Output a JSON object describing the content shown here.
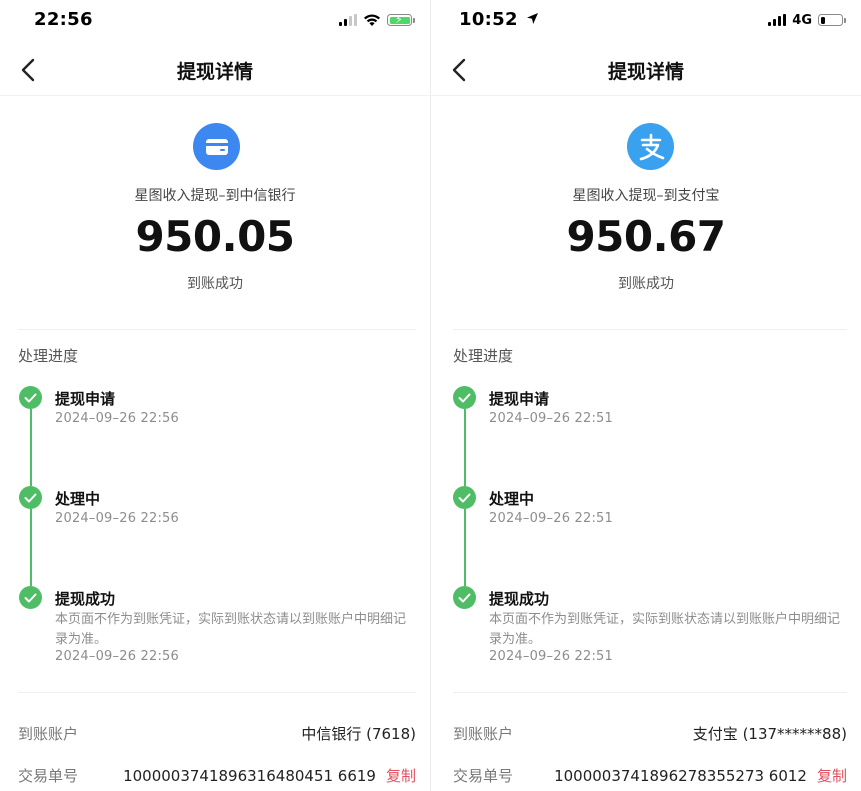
{
  "screens": [
    {
      "status": {
        "time": "22:56",
        "network": ""
      },
      "nav": {
        "title": "提现详情"
      },
      "summary": {
        "icon": "bank-card-icon",
        "description": "星图收入提现–到中信银行",
        "amount": "950.05",
        "state": "到账成功"
      },
      "progress": {
        "title": "处理进度",
        "steps": [
          {
            "title": "提现申请",
            "time": "2024–09–26 22:56"
          },
          {
            "title": "处理中",
            "time": "2024–09–26 22:56"
          },
          {
            "title": "提现成功",
            "note": "本页面不作为到账凭证，实际到账状态请以到账账户中明细记录为准。",
            "time": "2024–09–26 22:56"
          }
        ]
      },
      "info": {
        "account_label": "到账账户",
        "account_value": "中信银行 (7618)",
        "order_label": "交易单号",
        "order_value": "1000003741896316480451 6619",
        "copy_label": "复制"
      },
      "colors": {
        "icon_bg": "#3d87f0",
        "success": "#4ebd66",
        "copy": "#e0505f"
      }
    },
    {
      "status": {
        "time": "10:52",
        "network": "4G"
      },
      "nav": {
        "title": "提现详情"
      },
      "summary": {
        "icon": "alipay-icon",
        "description": "星图收入提现–到支付宝",
        "amount": "950.67",
        "state": "到账成功"
      },
      "progress": {
        "title": "处理进度",
        "steps": [
          {
            "title": "提现申请",
            "time": "2024–09–26 22:51"
          },
          {
            "title": "处理中",
            "time": "2024–09–26 22:51"
          },
          {
            "title": "提现成功",
            "note": "本页面不作为到账凭证，实际到账状态请以到账账户中明细记录为准。",
            "time": "2024–09–26 22:51"
          }
        ]
      },
      "info": {
        "account_label": "到账账户",
        "account_value": "支付宝 (137******88)",
        "order_label": "交易单号",
        "order_value": "1000003741896278355273 6012",
        "copy_label": "复制"
      },
      "colors": {
        "icon_bg": "#3aa1ef",
        "success": "#4ebd66",
        "copy": "#e0505f"
      }
    }
  ]
}
